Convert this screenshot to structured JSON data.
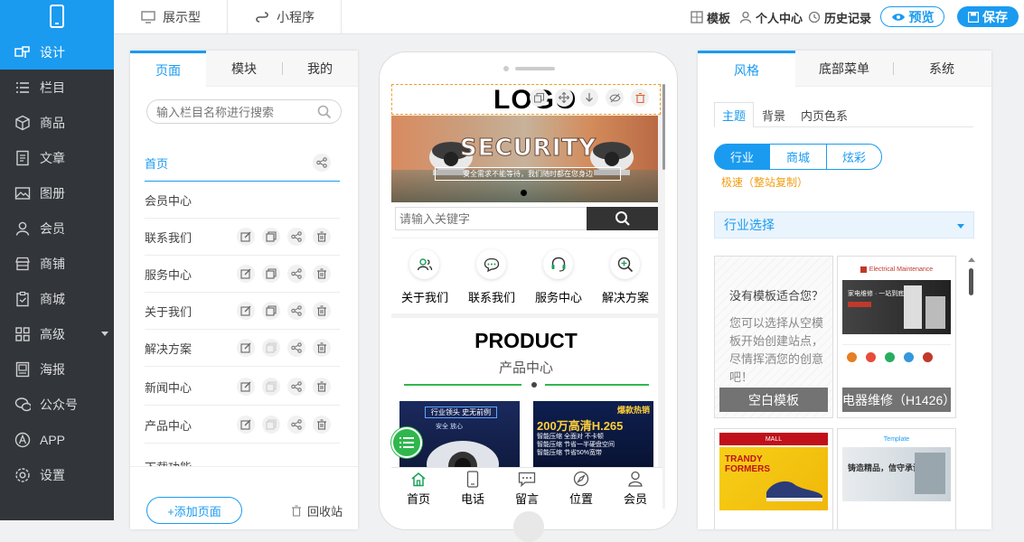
{
  "topbar": {
    "modes": [
      {
        "label": "展示型"
      },
      {
        "label": "小程序"
      }
    ],
    "actions": {
      "template": "模板",
      "user_center": "个人中心",
      "history": "历史记录",
      "preview": "预览",
      "save": "保存"
    }
  },
  "sidebar": {
    "items": [
      {
        "label": "设计"
      },
      {
        "label": "栏目"
      },
      {
        "label": "商品"
      },
      {
        "label": "文章"
      },
      {
        "label": "图册"
      },
      {
        "label": "会员"
      },
      {
        "label": "商铺"
      },
      {
        "label": "商城"
      },
      {
        "label": "高级"
      },
      {
        "label": "海报"
      },
      {
        "label": "公众号"
      },
      {
        "label": "APP"
      },
      {
        "label": "设置"
      }
    ]
  },
  "left_panel": {
    "tabs": [
      {
        "label": "页面"
      },
      {
        "label": "模块"
      },
      {
        "label": "我的"
      }
    ],
    "search_placeholder": "输入栏目名称进行搜索",
    "pages": [
      {
        "label": "首页"
      },
      {
        "label": "会员中心"
      },
      {
        "label": "联系我们"
      },
      {
        "label": "服务中心"
      },
      {
        "label": "关于我们"
      },
      {
        "label": "解决方案"
      },
      {
        "label": "新闻中心"
      },
      {
        "label": "产品中心"
      },
      {
        "label": "下载功能"
      }
    ],
    "add_page": "+添加页面",
    "recycle": "回收站"
  },
  "phone": {
    "logo": "LOGO",
    "banner_title": "SECURITY",
    "banner_sub": "安全需求不能等待，我们随时都在您身边",
    "search_placeholder": "请输入关键字",
    "quick_links": [
      {
        "label": "关于我们"
      },
      {
        "label": "联系我们"
      },
      {
        "label": "服务中心"
      },
      {
        "label": "解决方案"
      }
    ],
    "product_en": "PRODUCT",
    "product_cn": "产品中心",
    "product_cards": [
      {
        "title": "行业领头 史无前例",
        "tags": [
          "安全 放心"
        ]
      },
      {
        "title": "爆款热销",
        "headline": "200万高清H.265",
        "lines": [
          "智能压缩 全面对 不卡顿",
          "智能压缩 节省一半硬盘空间",
          "智能压缩 节省50%宽带"
        ]
      }
    ],
    "bottom_nav": [
      {
        "label": "首页"
      },
      {
        "label": "电话"
      },
      {
        "label": "留言"
      },
      {
        "label": "位置"
      },
      {
        "label": "会员"
      }
    ]
  },
  "right_panel": {
    "tabs": [
      {
        "label": "风格"
      },
      {
        "label": "底部菜单"
      },
      {
        "label": "系统"
      }
    ],
    "sub_tabs": [
      {
        "label": "主题"
      },
      {
        "label": "背景"
      },
      {
        "label": "内页色系"
      }
    ],
    "segments": [
      {
        "label": "行业"
      },
      {
        "label": "商城"
      },
      {
        "label": "炫彩"
      }
    ],
    "fast_link": "极速（整站复制）",
    "industry_select": "行业选择",
    "blank_card": {
      "title": "没有模板适合您？",
      "desc": "您可以选择从空模板开始创建站点，尽情挥洒您的创意吧！",
      "label": "空白模板"
    },
    "template_card": {
      "label": "电器维修（H1426）",
      "brand": "Electrical Maintenance",
      "headline": "家电维修 · 一站到底"
    },
    "thumb_mall": {
      "brand": "MALL",
      "text": "TRANDY FORMERS"
    },
    "thumb_quality": {
      "brand": "Template",
      "text": "铸造精品，信守承诺"
    }
  },
  "colors": {
    "accent": "#1a9bf0",
    "sidebar_bg": "#32363b",
    "green": "#2fb74d"
  }
}
